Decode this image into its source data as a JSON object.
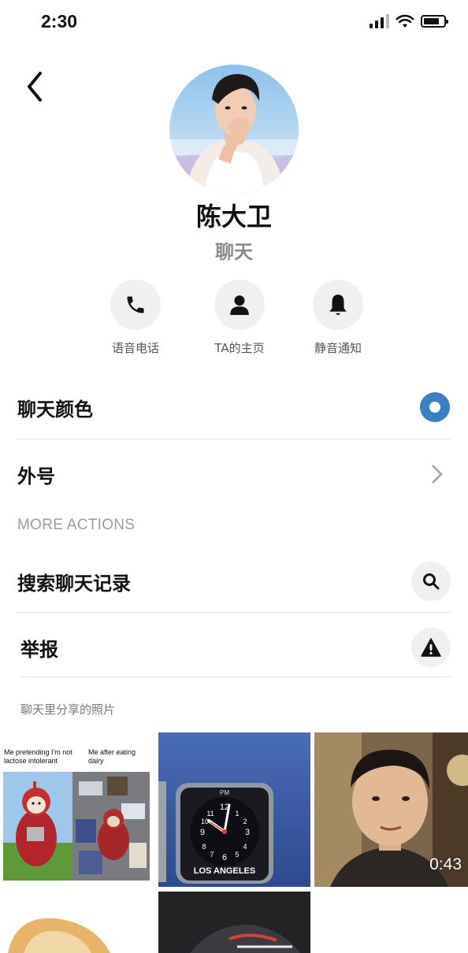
{
  "status_bar": {
    "time": "2:30",
    "icons": [
      "cellular-signal-icon",
      "wifi-icon",
      "battery-icon"
    ]
  },
  "header": {
    "back_icon": "chevron-left-icon",
    "name": "陈大卫",
    "subtitle": "聊天"
  },
  "quick_actions": [
    {
      "icon": "phone-icon",
      "label": "语音电话"
    },
    {
      "icon": "person-icon",
      "label": "TA的主页"
    },
    {
      "icon": "bell-icon",
      "label": "静音通知"
    }
  ],
  "settings": {
    "chat_color_label": "聊天颜色",
    "chat_color": "#3a7fc0",
    "nickname_label": "外号"
  },
  "more_actions": {
    "header": "MORE ACTIONS",
    "search_label": "搜索聊天记录",
    "search_icon": "search-icon",
    "report_label": "举报",
    "report_icon": "warning-icon"
  },
  "shared_photos": {
    "header": "聊天里分享的照片",
    "meme_caption_left": "Me pretending I'm not lactose intolerant",
    "meme_caption_right": "Me after eating dairy",
    "clock_label": "LOS ANGELES",
    "clock_period": "PM",
    "video_duration": "0:43"
  },
  "colors": {
    "accent": "#3a7fc0",
    "secondary_text": "#8a8a8a",
    "icon_background": "#f0f0f0"
  }
}
